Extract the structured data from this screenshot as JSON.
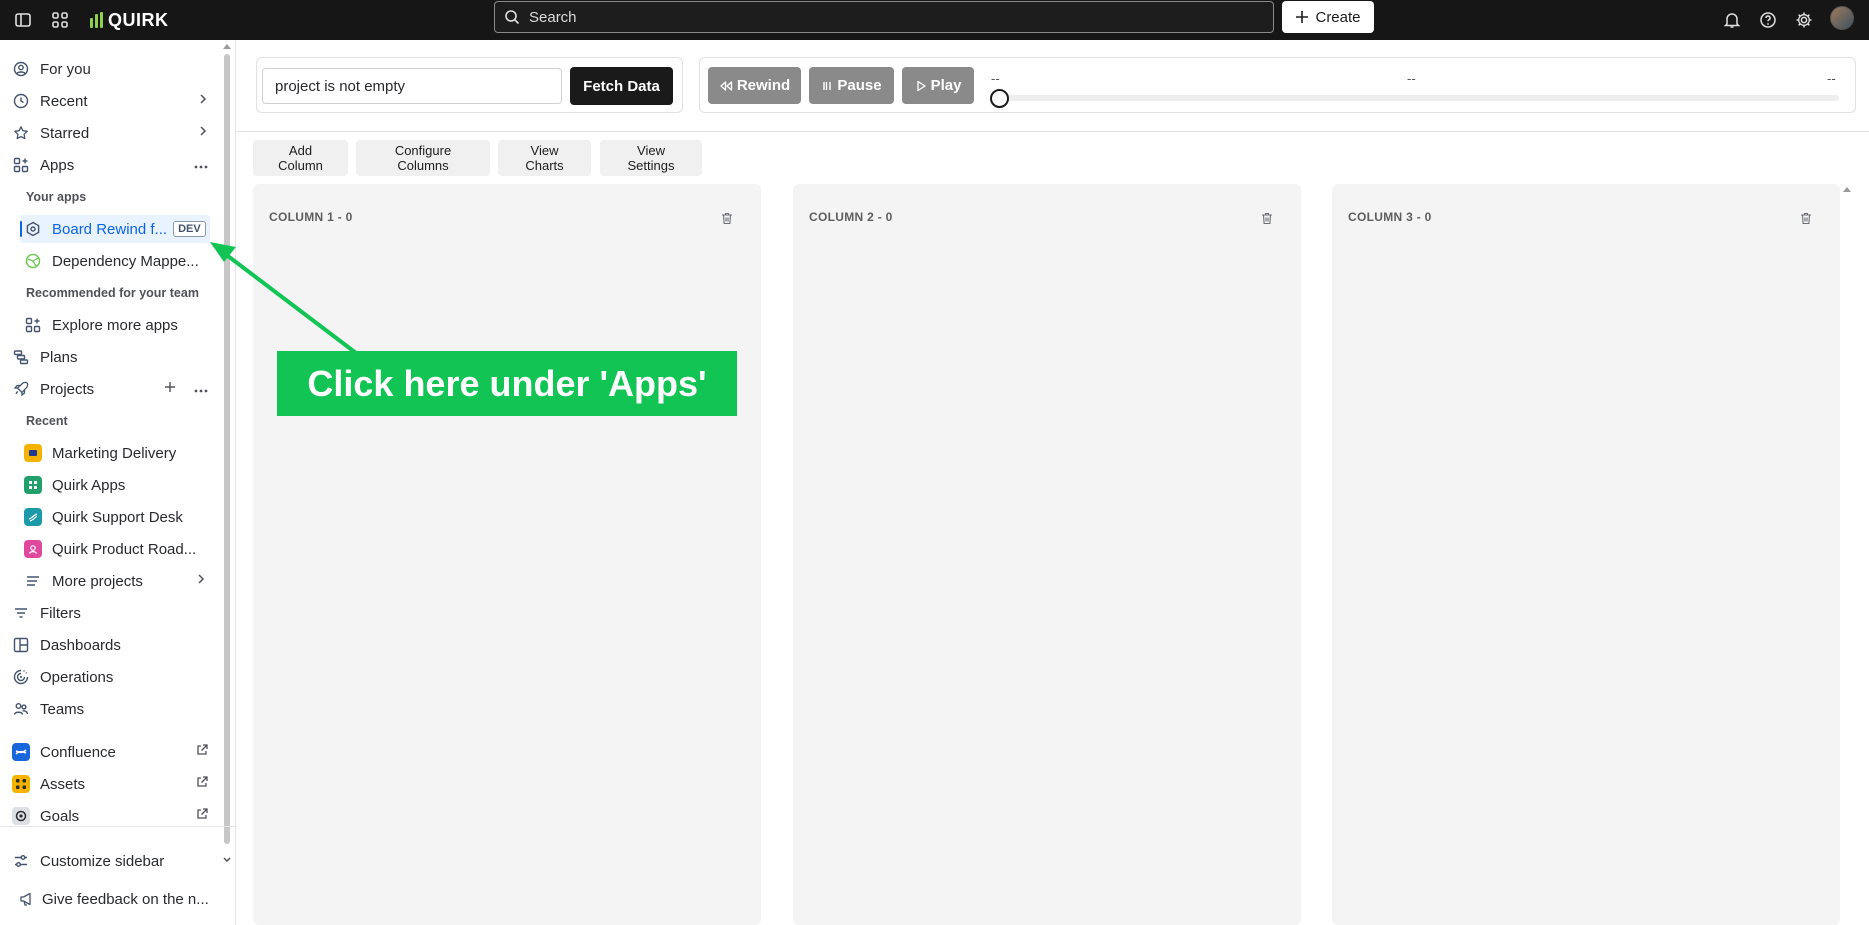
{
  "topbar": {
    "brand": "QUIRK",
    "search_placeholder": "Search",
    "create_label": "Create"
  },
  "sidebar": {
    "for_you": "For you",
    "recent": "Recent",
    "starred": "Starred",
    "apps": "Apps",
    "your_apps_header": "Your apps",
    "app_board_rewind": "Board Rewind f...",
    "app_board_rewind_badge": "DEV",
    "app_dependency": "Dependency Mappe...",
    "recommended_header": "Recommended for your team",
    "explore_apps": "Explore more apps",
    "plans": "Plans",
    "projects": "Projects",
    "recent_header": "Recent",
    "projects_list": [
      {
        "label": "Marketing Delivery",
        "color": "#f5b300"
      },
      {
        "label": "Quirk Apps",
        "color": "#22a06b"
      },
      {
        "label": "Quirk Support Desk",
        "color": "#1d9aaa"
      },
      {
        "label": "Quirk Product Road...",
        "color": "#e2479e"
      }
    ],
    "more_projects": "More projects",
    "filters": "Filters",
    "dashboards": "Dashboards",
    "operations": "Operations",
    "teams": "Teams",
    "confluence": "Confluence",
    "assets": "Assets",
    "goals": "Goals",
    "customize": "Customize sidebar",
    "feedback": "Give feedback on the n..."
  },
  "controls": {
    "filter_value": "project is not empty",
    "fetch_label": "Fetch Data",
    "rewind_label": "Rewind",
    "pause_label": "Pause",
    "play_label": "Play",
    "time_start": "--",
    "time_mid": "--",
    "time_end": "--",
    "slider_position": 0
  },
  "toolbar": {
    "add_column": "Add Column",
    "configure_columns": "Configure Columns",
    "view_charts": "View Charts",
    "view_settings": "View Settings"
  },
  "columns": [
    {
      "title": "COLUMN 1 - 0"
    },
    {
      "title": "COLUMN 2 - 0"
    },
    {
      "title": "COLUMN 3 - 0"
    }
  ],
  "annotation": {
    "text": "Click here under 'Apps'",
    "color": "#11c453"
  }
}
